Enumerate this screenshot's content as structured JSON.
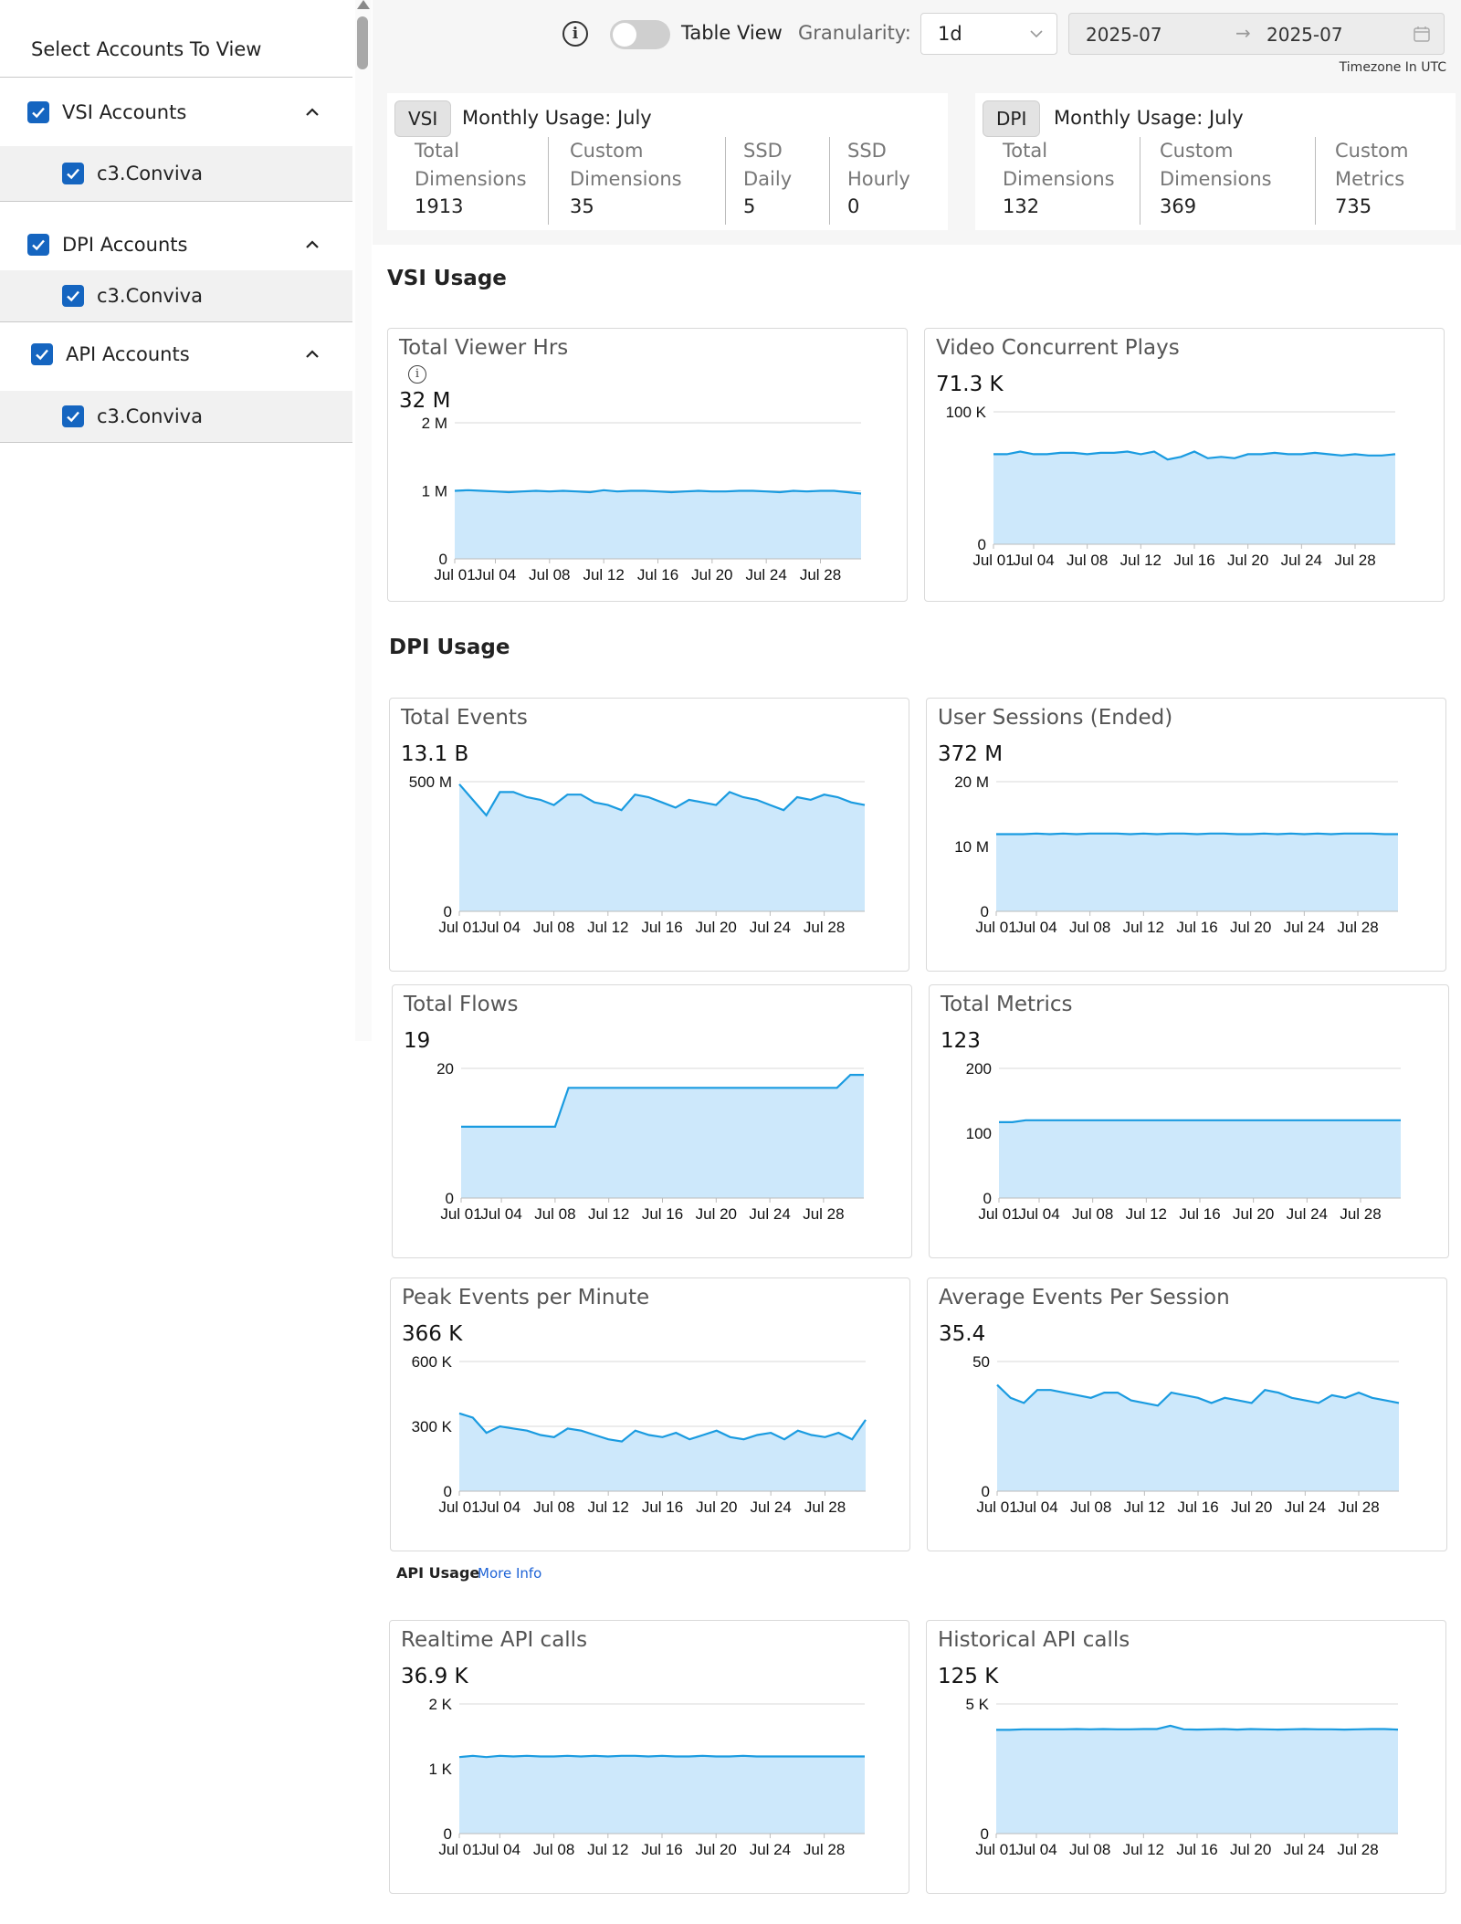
{
  "sidebar": {
    "title": "Select Accounts To View",
    "groups": [
      {
        "label": "VSI Accounts",
        "checked": true,
        "child": "c3.Conviva"
      },
      {
        "label": "DPI Accounts",
        "checked": true,
        "child": "c3.Conviva"
      },
      {
        "label": "API Accounts",
        "checked": true,
        "child": "c3.Conviva"
      }
    ]
  },
  "header": {
    "info_icon": "i",
    "table_view_label": "Table View",
    "table_view_on": false,
    "granularity_label": "Granularity:",
    "granularity_value": "1d",
    "date_from": "2025-07",
    "date_sep": "→",
    "date_to": "2025-07",
    "timezone": "Timezone In UTC"
  },
  "summary": {
    "vsi": {
      "tag": "VSI",
      "title": "Monthly Usage: July",
      "metrics": [
        {
          "l1": "Total",
          "l2": "Dimensions",
          "value": "1913"
        },
        {
          "l1": "Custom",
          "l2": "Dimensions",
          "value": "35"
        },
        {
          "l1": "SSD",
          "l2": "Daily",
          "value": "5"
        },
        {
          "l1": "SSD",
          "l2": "Hourly",
          "value": "0"
        }
      ]
    },
    "dpi": {
      "tag": "DPI",
      "title": "Monthly Usage: July",
      "metrics": [
        {
          "l1": "Total",
          "l2": "Dimensions",
          "value": "132"
        },
        {
          "l1": "Custom",
          "l2": "Dimensions",
          "value": "369"
        },
        {
          "l1": "Custom",
          "l2": "Metrics",
          "value": "735"
        }
      ]
    }
  },
  "sections": {
    "vsi": "VSI Usage",
    "dpi": "DPI Usage",
    "api": "API Usage",
    "api_more": "More Info"
  },
  "colors": {
    "area_fill": "#cde8fb",
    "line": "#1a9be0",
    "checkbox": "#1565c0"
  },
  "x_labels": [
    "Jul 01",
    "Jul 04",
    "Jul 08",
    "Jul 12",
    "Jul 16",
    "Jul 20",
    "Jul 24",
    "Jul 28"
  ],
  "chart_data": [
    {
      "id": "total-viewer-hrs",
      "type": "area",
      "title": "Total Viewer Hrs",
      "value": "32 M",
      "info": true,
      "yticks": [
        "2 M",
        "1 M",
        "0"
      ],
      "ylim": [
        0,
        2000000
      ],
      "values": [
        1000000,
        1010000,
        1000000,
        990000,
        980000,
        990000,
        1000000,
        990000,
        1000000,
        990000,
        980000,
        1010000,
        990000,
        1000000,
        1000000,
        990000,
        980000,
        990000,
        1000000,
        990000,
        990000,
        1000000,
        1000000,
        990000,
        980000,
        1000000,
        990000,
        1000000,
        1000000,
        980000,
        960000
      ]
    },
    {
      "id": "video-concurrent-plays",
      "type": "area",
      "title": "Video Concurrent Plays",
      "value": "71.3 K",
      "yticks": [
        "100 K",
        "0"
      ],
      "ylim": [
        0,
        100000
      ],
      "values": [
        68000,
        68000,
        70000,
        68000,
        68000,
        69000,
        69000,
        68000,
        69000,
        69000,
        70000,
        68000,
        70000,
        64000,
        66000,
        70000,
        65000,
        66000,
        65000,
        68000,
        68000,
        69000,
        68000,
        68000,
        69000,
        68000,
        67000,
        68000,
        67000,
        67000,
        68000
      ]
    },
    {
      "id": "total-events",
      "type": "area",
      "title": "Total Events",
      "value": "13.1 B",
      "yticks": [
        "500 M",
        "0"
      ],
      "ylim": [
        0,
        500000000
      ],
      "values": [
        490000000,
        430000000,
        370000000,
        460000000,
        460000000,
        440000000,
        430000000,
        410000000,
        450000000,
        450000000,
        420000000,
        410000000,
        390000000,
        450000000,
        440000000,
        420000000,
        400000000,
        430000000,
        420000000,
        410000000,
        460000000,
        440000000,
        430000000,
        410000000,
        390000000,
        440000000,
        430000000,
        450000000,
        440000000,
        420000000,
        410000000
      ]
    },
    {
      "id": "user-sessions-ended",
      "type": "area",
      "title": "User Sessions (Ended)",
      "value": "372 M",
      "yticks": [
        "20 M",
        "10 M",
        "0"
      ],
      "ylim": [
        0,
        20000000
      ],
      "values": [
        11900000,
        11900000,
        11900000,
        12000000,
        11900000,
        12000000,
        11900000,
        12000000,
        12000000,
        12000000,
        11900000,
        12000000,
        11900000,
        12000000,
        12000000,
        11900000,
        12000000,
        12000000,
        11900000,
        11900000,
        12000000,
        11900000,
        12000000,
        11900000,
        12000000,
        11900000,
        12000000,
        12000000,
        12000000,
        11900000,
        11900000
      ]
    },
    {
      "id": "total-flows",
      "type": "area",
      "title": "Total Flows",
      "value": "19",
      "yticks": [
        "20",
        "0"
      ],
      "ylim": [
        0,
        20
      ],
      "values": [
        11,
        11,
        11,
        11,
        11,
        11,
        11,
        11,
        17,
        17,
        17,
        17,
        17,
        17,
        17,
        17,
        17,
        17,
        17,
        17,
        17,
        17,
        17,
        17,
        17,
        17,
        17,
        17,
        17,
        19,
        19
      ]
    },
    {
      "id": "total-metrics",
      "type": "area",
      "title": "Total Metrics",
      "value": "123",
      "yticks": [
        "200",
        "100",
        "0"
      ],
      "ylim": [
        0,
        200
      ],
      "values": [
        117,
        117,
        120,
        120,
        120,
        120,
        120,
        120,
        120,
        120,
        120,
        120,
        120,
        120,
        120,
        120,
        120,
        120,
        120,
        120,
        120,
        120,
        120,
        120,
        120,
        120,
        120,
        120,
        120,
        120,
        120
      ]
    },
    {
      "id": "peak-events-per-minute",
      "type": "area",
      "title": "Peak Events per Minute",
      "value": "366 K",
      "yticks": [
        "600 K",
        "300 K",
        "0"
      ],
      "ylim": [
        0,
        600000
      ],
      "values": [
        360000,
        340000,
        270000,
        300000,
        290000,
        280000,
        260000,
        250000,
        290000,
        280000,
        260000,
        240000,
        230000,
        280000,
        260000,
        250000,
        270000,
        240000,
        260000,
        280000,
        250000,
        240000,
        260000,
        270000,
        240000,
        280000,
        260000,
        250000,
        270000,
        240000,
        330000
      ]
    },
    {
      "id": "average-events-per-session",
      "type": "area",
      "title": "Average Events Per Session",
      "value": "35.4",
      "yticks": [
        "50",
        "0"
      ],
      "ylim": [
        0,
        50
      ],
      "values": [
        41,
        36,
        34,
        39,
        39,
        38,
        37,
        36,
        38,
        38,
        35,
        34,
        33,
        38,
        37,
        36,
        34,
        36,
        35,
        34,
        39,
        38,
        36,
        35,
        34,
        37,
        36,
        38,
        36,
        35,
        34
      ]
    },
    {
      "id": "realtime-api-calls",
      "type": "area",
      "title": "Realtime API calls",
      "value": "36.9 K",
      "yticks": [
        "2 K",
        "1 K",
        "0"
      ],
      "ylim": [
        0,
        2000
      ],
      "values": [
        1180,
        1200,
        1180,
        1200,
        1190,
        1200,
        1190,
        1190,
        1200,
        1190,
        1200,
        1190,
        1200,
        1200,
        1190,
        1200,
        1190,
        1190,
        1200,
        1190,
        1190,
        1200,
        1190,
        1190,
        1190,
        1190,
        1190,
        1190,
        1190,
        1190,
        1190
      ]
    },
    {
      "id": "historical-api-calls",
      "type": "area",
      "title": "Historical API calls",
      "value": "125 K",
      "yticks": [
        "5 K",
        "0"
      ],
      "ylim": [
        0,
        5000
      ],
      "values": [
        4000,
        4000,
        4020,
        4020,
        4020,
        4020,
        4030,
        4020,
        4030,
        4020,
        4020,
        4030,
        4030,
        4160,
        4020,
        4010,
        4020,
        4030,
        4010,
        4030,
        4020,
        4010,
        4020,
        4030,
        4020,
        4020,
        4010,
        4020,
        4030,
        4030,
        4010
      ]
    }
  ]
}
